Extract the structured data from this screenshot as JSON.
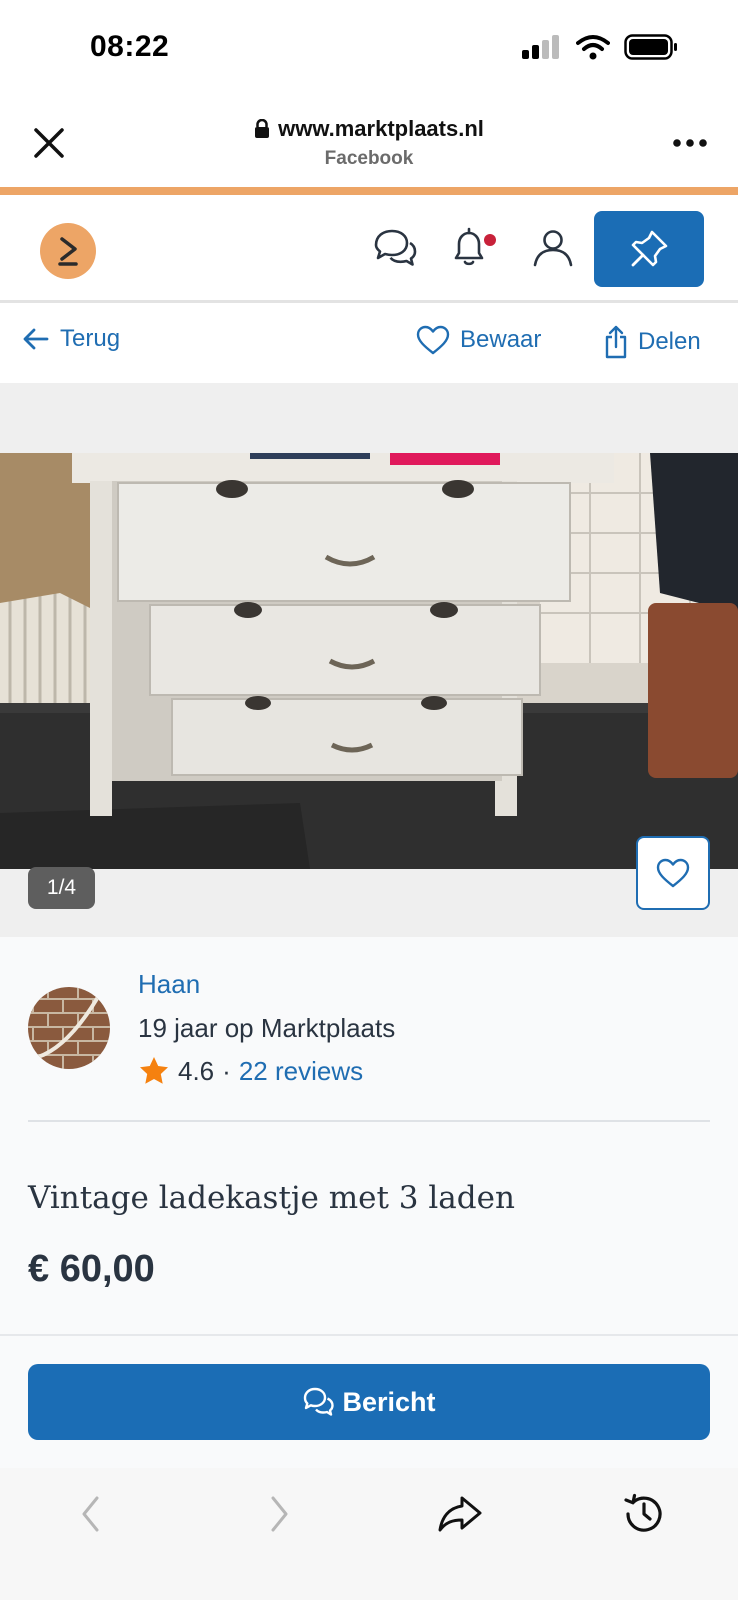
{
  "status": {
    "time": "08:22"
  },
  "browser": {
    "domain": "www.marktplaats.nl",
    "source": "Facebook"
  },
  "actions": {
    "back": "Terug",
    "save": "Bewaar",
    "share": "Delen"
  },
  "gallery": {
    "counter": "1/4"
  },
  "seller": {
    "name": "Haan",
    "member_since": "19 jaar op Marktplaats",
    "rating": "4.6",
    "separator": "·",
    "reviews": "22 reviews"
  },
  "listing": {
    "title": "Vintage ladekastje met 3 laden",
    "price": "€ 60,00"
  },
  "cta": {
    "message": "Bericht"
  },
  "colors": {
    "brand_blue": "#1b6db5",
    "brand_orange": "#eda566",
    "notification_red": "#c8213a",
    "star": "#f5810f"
  }
}
